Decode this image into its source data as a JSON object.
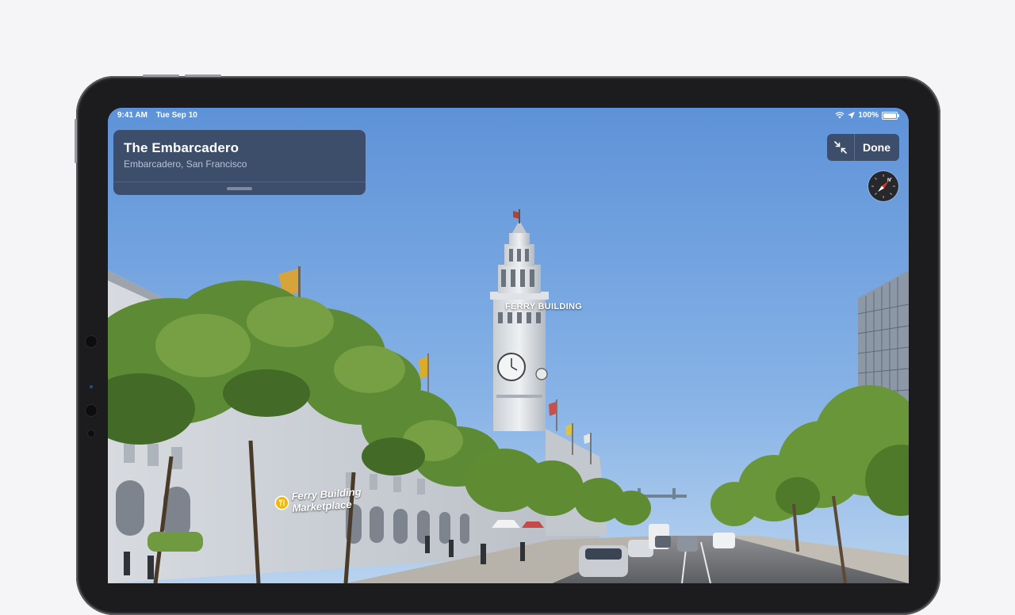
{
  "status_bar": {
    "time": "9:41 AM",
    "date": "Tue Sep 10",
    "battery": "100%",
    "icons": [
      "wifi-icon",
      "location-arrow-icon",
      "battery-icon"
    ]
  },
  "place_card": {
    "title": "The Embarcadero",
    "subtitle": "Embarcadero, San Francisco"
  },
  "controls": {
    "collapse_icon": "collapse-arrows-icon",
    "done_label": "Done",
    "compass_icon": "compass-icon"
  },
  "labels": {
    "landmark": "FERRY BUILDING",
    "poi_line1": "Ferry Building",
    "poi_line2": "Marketplace",
    "poi_icon": "restaurant-pin-icon"
  },
  "colors": {
    "card_background": "#3a4862",
    "poi_pin": "#f5b800",
    "sky": "#7aa9e2",
    "compass_needle": "#e0322b"
  }
}
